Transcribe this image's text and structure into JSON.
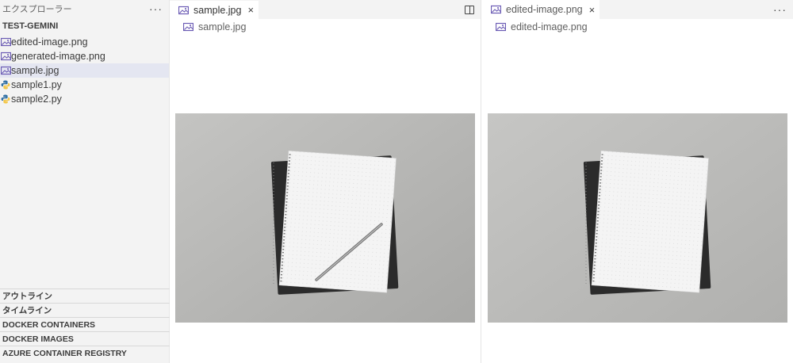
{
  "sidebar": {
    "header": "エクスプローラー",
    "more": "···",
    "folder": "TEST-GEMINI",
    "files": [
      {
        "label": "edited-image.png",
        "icon": "image-file-icon",
        "selected": false
      },
      {
        "label": "generated-image.png",
        "icon": "image-file-icon",
        "selected": false
      },
      {
        "label": "sample.jpg",
        "icon": "image-file-icon",
        "selected": true
      },
      {
        "label": "sample1.py",
        "icon": "python-file-icon",
        "selected": false
      },
      {
        "label": "sample2.py",
        "icon": "python-file-icon",
        "selected": false
      }
    ],
    "sections": [
      "アウトライン",
      "タイムライン",
      "DOCKER CONTAINERS",
      "DOCKER IMAGES",
      "AZURE CONTAINER REGISTRY"
    ]
  },
  "editor1": {
    "tab_label": "sample.jpg",
    "close": "×",
    "breadcrumb": "sample.jpg"
  },
  "editor2": {
    "tab_label": "edited-image.png",
    "close": "×",
    "breadcrumb": "edited-image.png",
    "more": "···"
  },
  "colors": {
    "sidebar_bg": "#f3f3f3",
    "selected_row": "#e4e6f1",
    "image_icon": "#6b5bb4",
    "python_icon_blue": "#3572a5",
    "python_icon_yellow": "#f3c74a"
  }
}
